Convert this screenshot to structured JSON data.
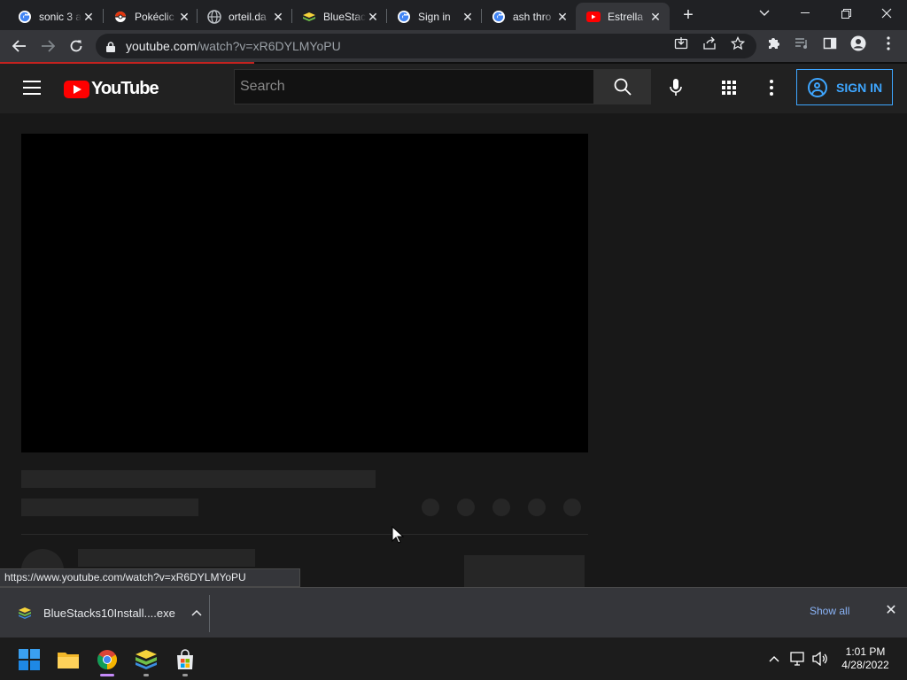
{
  "browser": {
    "tabs": [
      {
        "title": "sonic 3 a",
        "favicon": "google-icon",
        "active": false
      },
      {
        "title": "Pokéclic",
        "favicon": "pokeball-icon",
        "active": false
      },
      {
        "title": "orteil.da",
        "favicon": "globe-icon",
        "active": false
      },
      {
        "title": "BlueStac",
        "favicon": "bluestacks-icon",
        "active": false
      },
      {
        "title": "Sign in",
        "favicon": "google-icon",
        "active": false
      },
      {
        "title": "ash thro",
        "favicon": "google-icon",
        "active": false
      },
      {
        "title": "Estrella",
        "favicon": "youtube-icon",
        "active": true
      }
    ],
    "url_domain": "youtube.com",
    "url_path": "/watch?v=xR6DYLMYoPU",
    "status_url": "https://www.youtube.com/watch?v=xR6DYLMYoPU",
    "load_progress": 0.28
  },
  "youtube": {
    "logo_text": "YouTube",
    "search_placeholder": "Search",
    "sign_in_label": "SIGN IN"
  },
  "download_shelf": {
    "file_name": "BlueStacks10Install....exe",
    "show_all_label": "Show all"
  },
  "taskbar": {
    "time": "1:01 PM",
    "date": "4/28/2022"
  },
  "colors": {
    "yt_red": "#ff0000",
    "sign_in_blue": "#3ea6ff",
    "progress_red": "#c5221f",
    "link_blue": "#8ab4f8"
  }
}
